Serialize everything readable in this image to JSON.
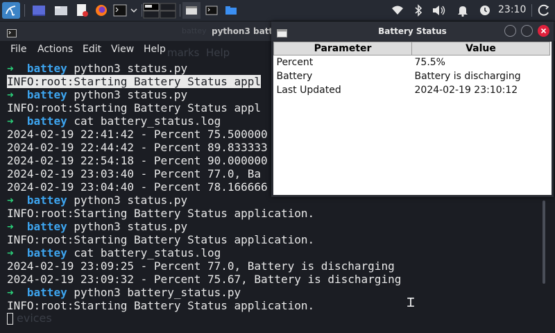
{
  "panel": {
    "clock": "23:10"
  },
  "terminal": {
    "title": "python3 batter",
    "menus": [
      "File",
      "Actions",
      "Edit",
      "View",
      "Help"
    ],
    "ghost_texts": [
      "battey",
      "marks",
      "Help",
      "evices"
    ],
    "lines": [
      {
        "type": "prompt",
        "user": "battey",
        "cmd": "python3 status.py"
      },
      {
        "type": "out_hl",
        "text": "INFO:root:Starting Battery Status appl"
      },
      {
        "type": "prompt",
        "user": "battey",
        "cmd": "python3 status.py"
      },
      {
        "type": "out",
        "text": "INFO:root:Starting Battery Status appl"
      },
      {
        "type": "prompt",
        "user": "battey",
        "cmd": "cat battery_status.log"
      },
      {
        "type": "out",
        "text": "2024-02-19 22:41:42 - Percent 75.500000"
      },
      {
        "type": "out",
        "text": "2024-02-19 22:44:42 - Percent 89.833333"
      },
      {
        "type": "out",
        "text": "2024-02-19 22:54:18 - Percent 90.000000"
      },
      {
        "type": "out",
        "text": "2024-02-19 23:03:40 - Percent 77.0, Ba"
      },
      {
        "type": "out",
        "text": "2024-02-19 23:04:40 - Percent 78.166666"
      },
      {
        "type": "prompt",
        "user": "battey",
        "cmd": "python3 status.py"
      },
      {
        "type": "out",
        "text": "INFO:root:Starting Battery Status application."
      },
      {
        "type": "prompt",
        "user": "battey",
        "cmd": "python3 status.py"
      },
      {
        "type": "out",
        "text": "INFO:root:Starting Battery Status application."
      },
      {
        "type": "prompt",
        "user": "battey",
        "cmd": "cat battery_status.log"
      },
      {
        "type": "out",
        "text": "2024-02-19 23:09:25 - Percent 77.0, Battery is discharging"
      },
      {
        "type": "out",
        "text": "2024-02-19 23:09:32 - Percent 75.67, Battery is discharging"
      },
      {
        "type": "prompt",
        "user": "battey",
        "cmd": "python3 battery_status.py"
      },
      {
        "type": "out",
        "text": "INFO:root:Starting Battery Status application."
      },
      {
        "type": "cursor"
      }
    ]
  },
  "battery_window": {
    "title": "Battery Status",
    "headers": [
      "Parameter",
      "Value"
    ],
    "rows": [
      [
        "Percent",
        "75.5%"
      ],
      [
        "Battery",
        "Battery is discharging"
      ],
      [
        "Last Updated",
        "2024-02-19 23:10:12"
      ]
    ]
  },
  "colors": {
    "prompt_arrow": "#2bd07a",
    "prompt_user": "#3da5f0",
    "close_button": "#e0213c"
  },
  "icons": [
    "kali-menu-icon",
    "show-desktop-icon",
    "file-manager-icon",
    "text-editor-icon",
    "firefox-icon",
    "terminal-icon",
    "workspace-switcher-icon",
    "wifi-icon",
    "bluetooth-icon",
    "volume-icon",
    "notification-bell-icon",
    "power-icon",
    "refresh-icon"
  ]
}
